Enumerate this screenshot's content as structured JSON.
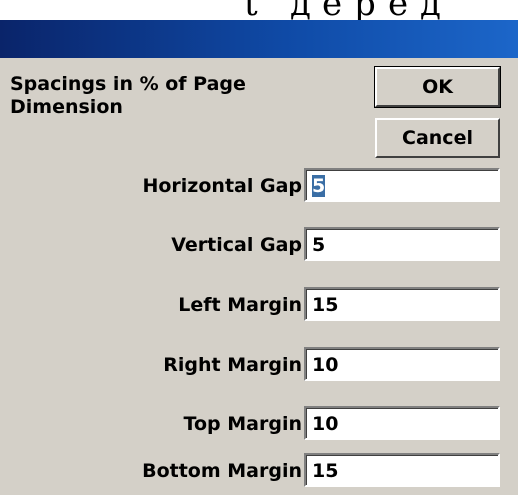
{
  "background_text": [
    "t",
    "д",
    "е",
    "р",
    "е",
    "д"
  ],
  "dialog": {
    "heading": "Spacings in % of Page Dimension",
    "ok_label": "OK",
    "cancel_label": "Cancel",
    "fields": [
      {
        "label": "Horizontal Gap",
        "value": "5",
        "selected": true
      },
      {
        "label": "Vertical Gap",
        "value": "5"
      },
      {
        "label": "Left Margin",
        "value": "15"
      },
      {
        "label": "Right Margin",
        "value": "10"
      },
      {
        "label": "Top Margin",
        "value": "10"
      },
      {
        "label": "Bottom Margin",
        "value": "15"
      }
    ]
  },
  "colors": {
    "titlebar": "#0a246a",
    "dialog_face": "#d4d0c8",
    "selection": "#3a6ea5"
  }
}
